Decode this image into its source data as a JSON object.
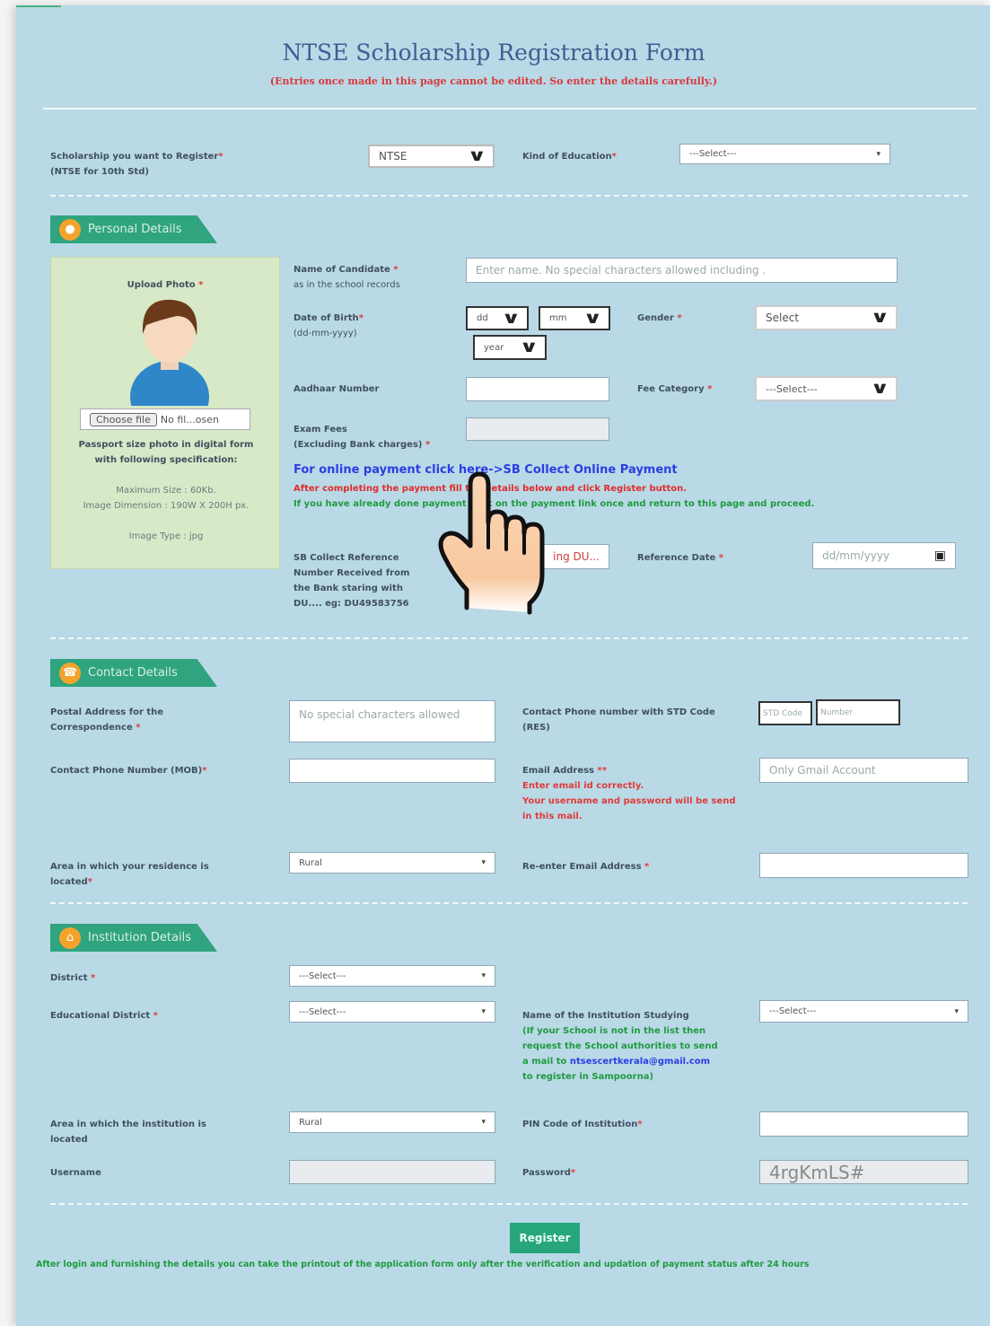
{
  "form": {
    "title": "NTSE Scholarship Registration Form",
    "subtitle": "(Entries once made in this page cannot be edited. So enter the details carefully.)"
  },
  "scholarship": {
    "label": "Scholarship you want to Register",
    "sublabel": "(NTSE for 10th Std)",
    "value": "NTSE",
    "kind_label": "Kind of Education",
    "kind_value": "---Select---"
  },
  "personal": {
    "section_title": "Personal Details",
    "upload_label": "Upload Photo",
    "choose_file": "Choose file",
    "no_file": "No fil...osen",
    "photo_spec_title": "Passport size photo in digital form with following specification:",
    "photo_spec_size": "Maximum Size : 60Kb.",
    "photo_spec_dim": "Image Dimension : 190W X 200H px.",
    "photo_spec_type": "Image Type : jpg",
    "name_label": "Name of Candidate",
    "name_sublabel": "as in the school records",
    "name_placeholder": "Enter name. No special characters allowed including .",
    "dob_label": "Date of Birth",
    "dob_sublabel": "(dd-mm-yyyy)",
    "dob_dd": "dd",
    "dob_mm": "mm",
    "dob_yyyy": "year",
    "gender_label": "Gender",
    "gender_value": "Select",
    "aadhaar_label": "Aadhaar Number",
    "fee_cat_label": "Fee Category",
    "fee_cat_value": "---Select---",
    "exam_fees_label": "Exam Fees",
    "exam_fees_sublabel": "(Excluding Bank charges)",
    "payment_link": "For online payment click here->SB Collect Online Payment",
    "after_payment_note": "After completing the payment fill the details below and click Register button.",
    "already_paid_note": "If you have already done payment click on the payment link once and return to this page and proceed.",
    "sb_ref_label": "SB Collect Reference Number Received from the Bank staring with DU.... eg: DU49583756",
    "sb_ref_placeholder": "ing DU...",
    "ref_date_label": "Reference Date",
    "ref_date_placeholder": "dd/mm/yyyy"
  },
  "contact": {
    "section_title": "Contact Details",
    "postal_label": "Postal Address for the Correspondence",
    "postal_placeholder": "No special characters allowed",
    "phone_std_label": "Contact Phone number with STD Code (RES)",
    "std_placeholder": "STD Code",
    "number_placeholder": "Number",
    "mob_label": "Contact Phone Number (MOB)",
    "email_label": "Email Address",
    "email_note1": "Enter email id correctly.",
    "email_note2": "Your username and password will be send in this mail.",
    "email_placeholder": "Only Gmail Account",
    "area_label": "Area in which your residence is located",
    "area_value": "Rural",
    "reemail_label": "Re-enter Email Address"
  },
  "institution": {
    "section_title": "Institution Details",
    "district_label": "District",
    "district_value": "---Select---",
    "edu_district_label": "Educational District",
    "edu_district_value": "---Select---",
    "inst_name_label": "Name of the Institution Studying",
    "inst_note_1": "(If your School is not in the list then request the School authorities to send a mail to",
    "inst_email": "ntsescertkerala@gmail.com",
    "inst_note_2": "to register in Sampoorna)",
    "inst_value": "---Select---",
    "inst_area_label": "Area in which the institution is located",
    "inst_area_value": "Rural",
    "pin_label": "PIN Code of Institution",
    "username_label": "Username",
    "password_label": "Password",
    "password_value": "4rgKmLS#"
  },
  "footer": {
    "register_button": "Register",
    "note": "After login and furnishing the details you can take the printout of the application form only after the verification and updation of payment status after 24 hours"
  },
  "icons": {
    "pointer": "hand-pointer-icon"
  }
}
